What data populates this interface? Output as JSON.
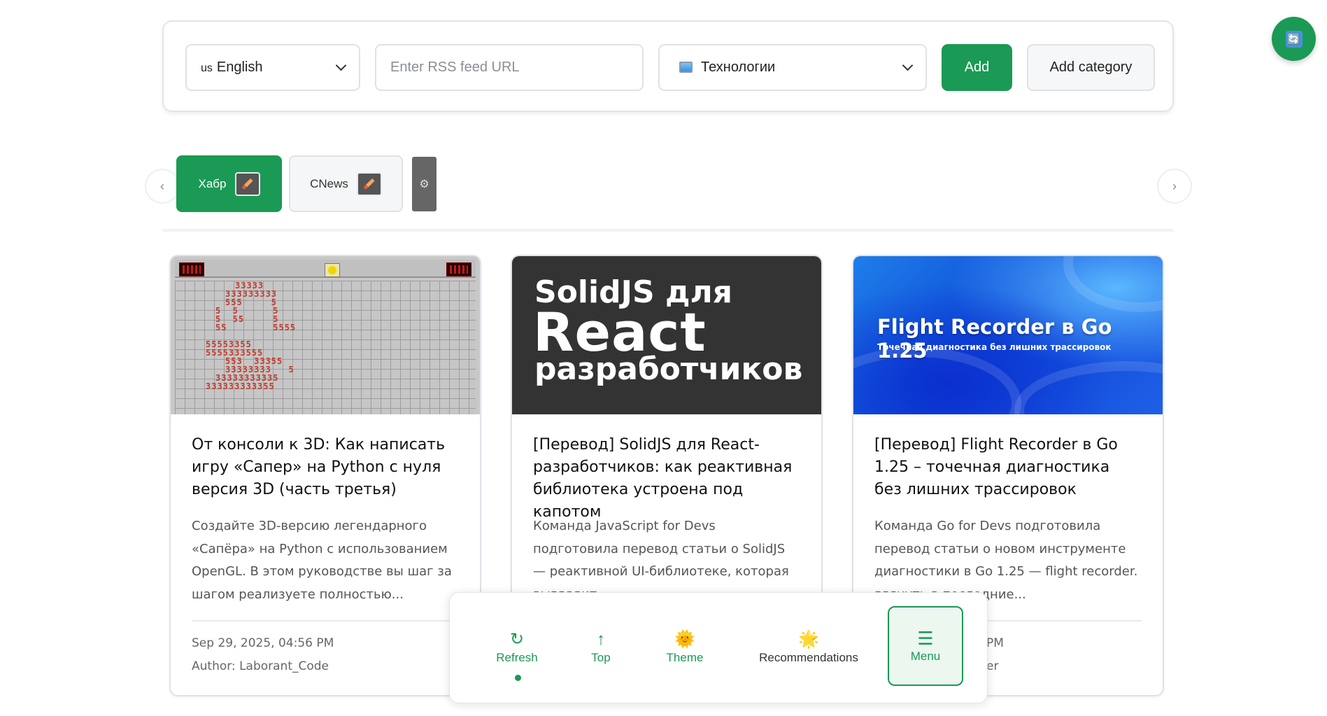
{
  "toolbar": {
    "language": {
      "flag": "us",
      "label": "English"
    },
    "rss_input": {
      "placeholder": "Enter RSS feed URL",
      "value": ""
    },
    "category": {
      "icon": "computer-icon",
      "label": "Технологии"
    },
    "add_label": "Add",
    "add_category_label": "Add category"
  },
  "sources": {
    "prev_label": "‹",
    "next_label": "›",
    "items": [
      {
        "label": "Хабр",
        "active": true,
        "edit_icon": "pencil-icon"
      },
      {
        "label": "CNews",
        "active": false,
        "edit_icon": "pencil-icon"
      }
    ],
    "settings_icon": "⚙"
  },
  "articles": [
    {
      "title": "От консоли к 3D: Как написать игру «Сапер» на Python с нуля версия 3D (часть третья)",
      "description": "Создайте 3D-версию легендарного «Сапёра» на Python с использованием OpenGL. В этом руководстве вы шаг за шагом реализуете полностью...",
      "date": "Sep 29, 2025, 04:56 PM",
      "author": "Author: Laborant_Code",
      "image": "minesweeper-screenshot"
    },
    {
      "title": "[Перевод] SolidJS для React-разработчиков: как реактивная библиотека устроена под капотом",
      "description": "Команда JavaScript for Devs подготовила перевод статьи о SolidJS — реактивной UI-библиотеке, которая выглядит",
      "image_text": {
        "line1": "SolidJS для",
        "line2": "React",
        "line3": "разработчиков"
      }
    },
    {
      "title": "[Перевод] Flight Recorder в Go 1.25 – точечная диагностика без лишних трассировок",
      "description": "Команда Go for Devs подготовила перевод статьи о новом инструменте диагностики в Go 1.25 — flight recorder.",
      "desc_tail": "глянуть в последние...",
      "date_tail": "PM",
      "author_tail": "er",
      "image_text": {
        "title": "Flight Recorder в Go 1.25",
        "subtitle": "Точечная диагностика без лишних трассировок"
      }
    }
  ],
  "bottom_nav": {
    "refresh": {
      "icon": "↻",
      "label": "Refresh"
    },
    "top": {
      "icon": "↑",
      "label": "Top"
    },
    "theme": {
      "icon": "🌞",
      "label": "Theme"
    },
    "recommendations": {
      "icon": "🌟",
      "label": "Recommendations"
    },
    "menu": {
      "icon": "☰",
      "label": "Menu"
    }
  },
  "fab": {
    "icon": "🔄"
  },
  "colors": {
    "accent": "#1a9a54",
    "accent_light": "#ecf7f0",
    "text": "#1f2328",
    "muted": "#666666"
  }
}
